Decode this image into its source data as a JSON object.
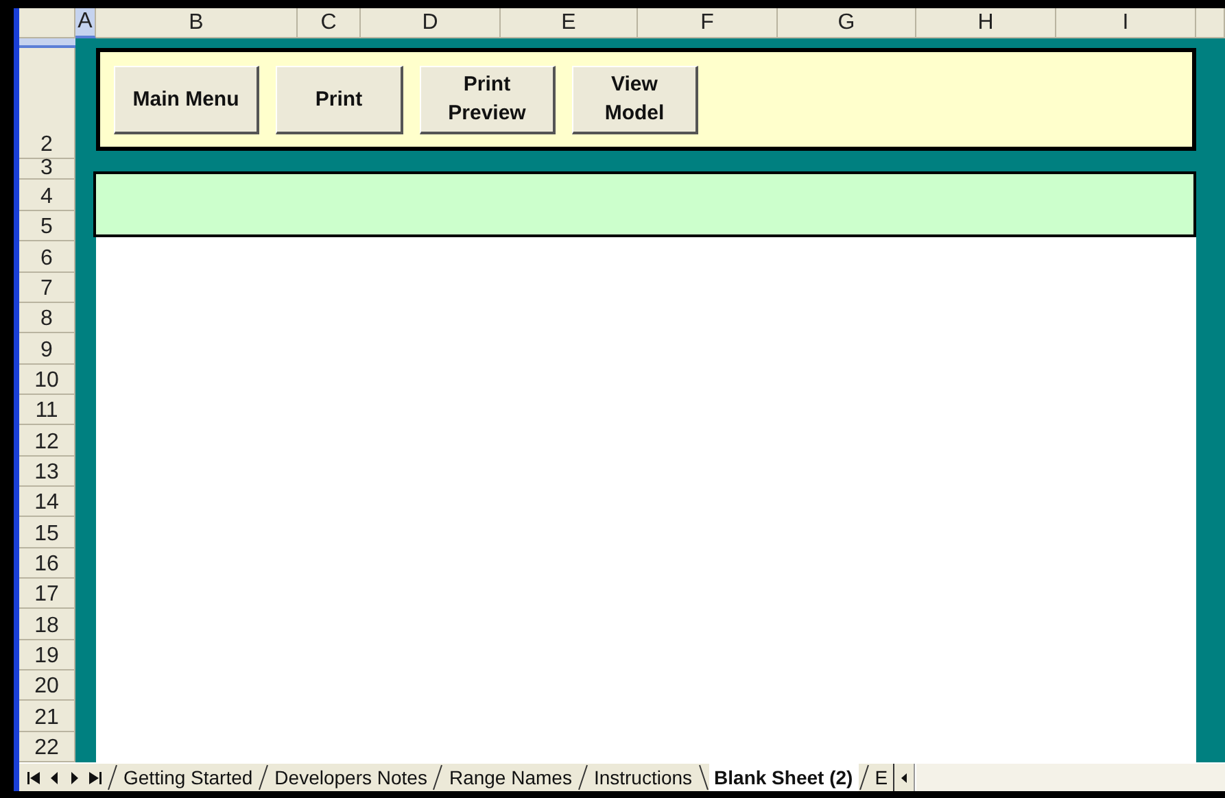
{
  "columns": [
    {
      "label": "A",
      "selected": true
    },
    {
      "label": "B",
      "selected": false
    },
    {
      "label": "C",
      "selected": false
    },
    {
      "label": "D",
      "selected": false
    },
    {
      "label": "E",
      "selected": false
    },
    {
      "label": "F",
      "selected": false
    },
    {
      "label": "G",
      "selected": false
    },
    {
      "label": "H",
      "selected": false
    },
    {
      "label": "I",
      "selected": false
    }
  ],
  "rows": [
    "2",
    "3",
    "4",
    "5",
    "6",
    "7",
    "8",
    "9",
    "10",
    "11",
    "12",
    "13",
    "14",
    "15",
    "16",
    "17",
    "18",
    "19",
    "20",
    "21",
    "22"
  ],
  "buttons": [
    {
      "label": "Main Menu"
    },
    {
      "label": "Print"
    },
    {
      "label": "Print\nPreview"
    },
    {
      "label": "View\nModel"
    }
  ],
  "sheet_tabs": [
    {
      "label": "Getting Started",
      "selected": false
    },
    {
      "label": "Developers Notes",
      "selected": false
    },
    {
      "label": "Range Names",
      "selected": false
    },
    {
      "label": "Instructions",
      "selected": false
    },
    {
      "label": "Blank Sheet (2)",
      "selected": true
    },
    {
      "label": "E",
      "selected": false
    }
  ]
}
